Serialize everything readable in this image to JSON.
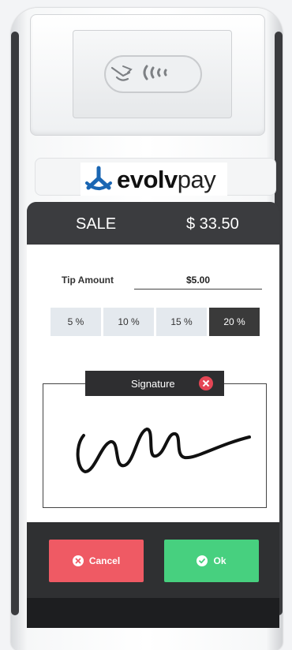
{
  "brand": {
    "logo_bold": "evolv",
    "logo_light": "pay",
    "accent": "#1a66b3"
  },
  "header": {
    "title": "SALE",
    "amount": "$ 33.50"
  },
  "tip": {
    "label": "Tip Amount",
    "value": "$5.00",
    "options": [
      {
        "label": "5 %",
        "selected": false
      },
      {
        "label": "10 %",
        "selected": false
      },
      {
        "label": "15 %",
        "selected": false
      },
      {
        "label": "20 %",
        "selected": true
      }
    ]
  },
  "signature": {
    "label": "Signature",
    "clear_icon": "close-circle-icon"
  },
  "actions": {
    "cancel_label": "Cancel",
    "ok_label": "Ok",
    "cancel_color": "#ef5a64",
    "ok_color": "#47d07f"
  }
}
